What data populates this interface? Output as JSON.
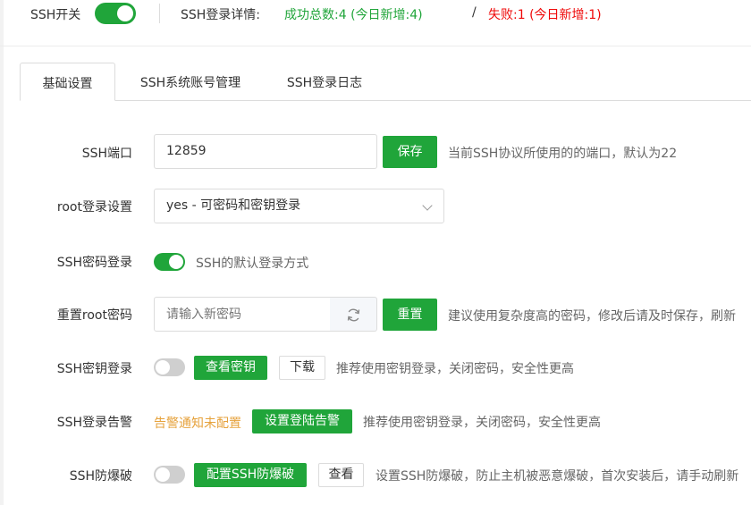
{
  "topbar": {
    "ssh_switch_label": "SSH开关",
    "ssh_switch_on": true,
    "detail_label": "SSH登录详情:",
    "success_text": "成功总数:4 (今日新增:4)",
    "slash": "/",
    "fail_text": "失败:1 (今日新增:1)"
  },
  "tabs": [
    {
      "label": "基础设置",
      "active": true
    },
    {
      "label": "SSH系统账号管理",
      "active": false
    },
    {
      "label": "SSH登录日志",
      "active": false
    }
  ],
  "port": {
    "label": "SSH端口",
    "value": "12859",
    "save_label": "保存",
    "hint": "当前SSH协议所使用的的端口，默认为22"
  },
  "root_login": {
    "label": "root登录设置",
    "selected": "yes - 可密码和密钥登录"
  },
  "password_login": {
    "label": "SSH密码登录",
    "enabled": true,
    "hint": "SSH的默认登录方式"
  },
  "reset_root": {
    "label": "重置root密码",
    "placeholder": "请输入新密码",
    "reset_label": "重置",
    "hint": "建议使用复杂度高的密码，修改后请及时保存，刷新"
  },
  "key_login": {
    "label": "SSH密钥登录",
    "enabled": false,
    "view_key_label": "查看密钥",
    "download_label": "下载",
    "hint": "推荐使用密钥登录，关闭密码，安全性更高"
  },
  "login_alert": {
    "label": "SSH登录告警",
    "warn": "告警通知未配置",
    "config_label": "设置登陆告警",
    "hint": "推荐使用密钥登录，关闭密码，安全性更高"
  },
  "anti_brute": {
    "label": "SSH防爆破",
    "enabled": false,
    "config_label": "配置SSH防爆破",
    "view_label": "查看",
    "hint": "设置SSH防爆破，防止主机被恶意爆破，首次安装后，请手动刷新"
  },
  "colors": {
    "accent": "#20a53a",
    "danger": "#ef0808",
    "warning": "#e6a23c"
  }
}
